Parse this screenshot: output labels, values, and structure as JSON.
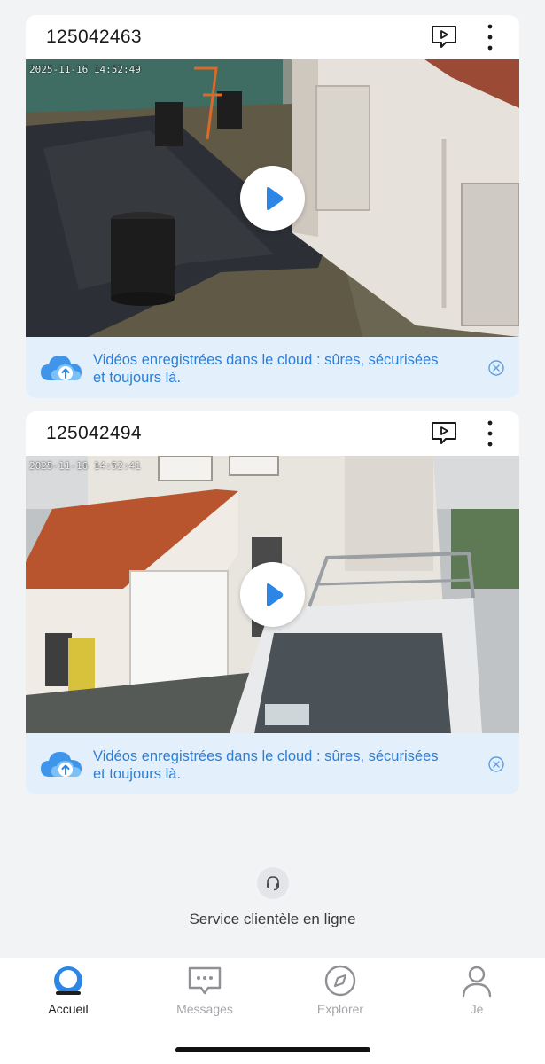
{
  "colors": {
    "accent": "#2b86e8",
    "banner_bg": "#e3effb",
    "banner_text": "#2b7fd8",
    "background": "#f2f3f5"
  },
  "cameras": [
    {
      "name": "125042463",
      "timestamp": "2025-11-16 14:52:49",
      "cloud_banner": "Vidéos enregistrées dans le cloud : sûres, sécurisées et toujours là."
    },
    {
      "name": "125042494",
      "timestamp": "2025-11-16 14:52:41",
      "cloud_banner": "Vidéos enregistrées dans le cloud : sûres, sécurisées et toujours là."
    }
  ],
  "support": {
    "label": "Service clientèle en ligne",
    "icon": "headset-icon"
  },
  "tabs": [
    {
      "label": "Accueil",
      "icon": "home-icon",
      "active": true
    },
    {
      "label": "Messages",
      "icon": "message-icon",
      "active": false
    },
    {
      "label": "Explorer",
      "icon": "compass-icon",
      "active": false
    },
    {
      "label": "Je",
      "icon": "user-icon",
      "active": false
    }
  ]
}
